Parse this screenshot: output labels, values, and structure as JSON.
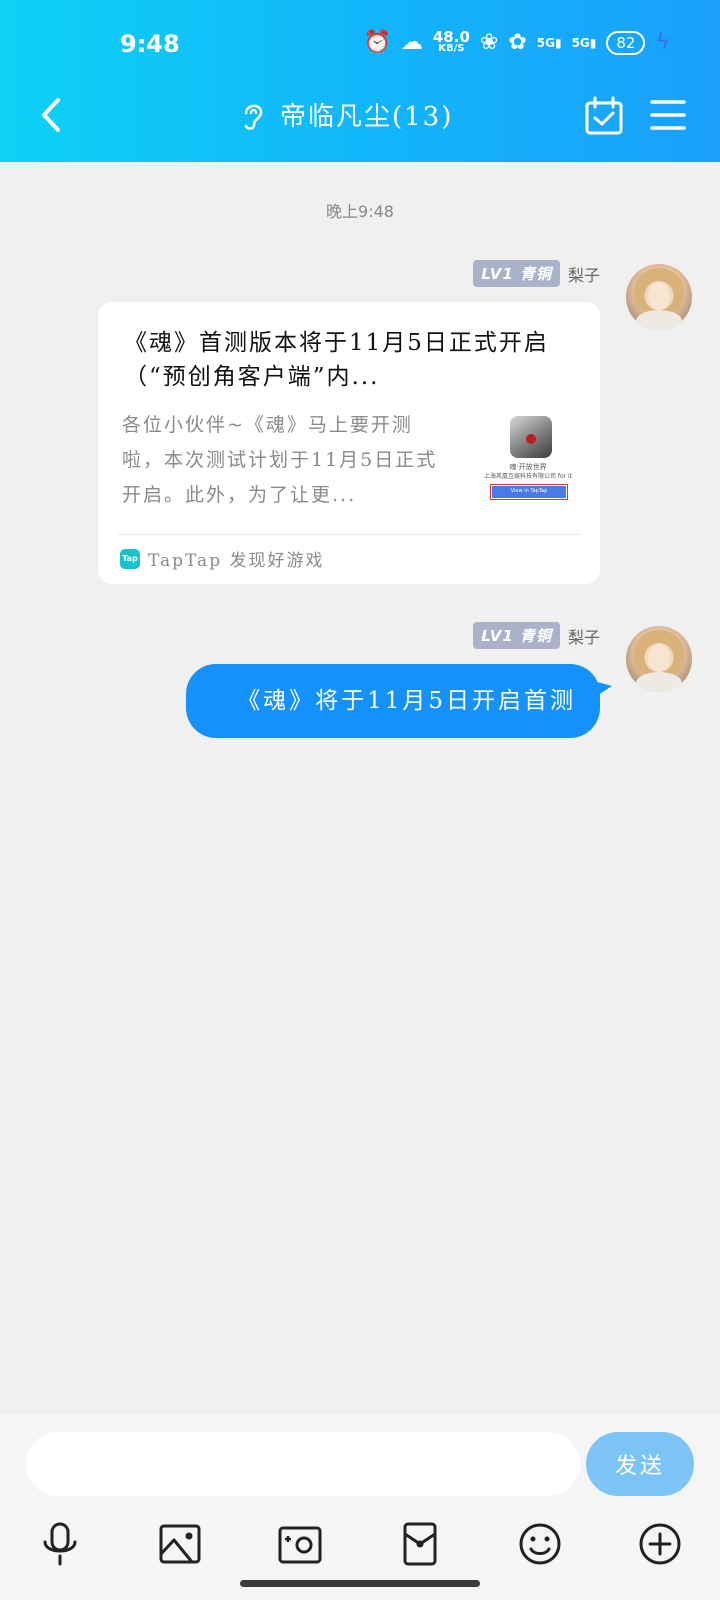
{
  "status_bar": {
    "time": "9:48",
    "net_speed_value": "48.0",
    "net_speed_unit": "KB/S",
    "signal1": "5G",
    "signal2": "5G",
    "battery": "82"
  },
  "header": {
    "title": "帝临凡尘(13)"
  },
  "chat": {
    "timestamp": "晚上9:48",
    "messages": [
      {
        "badge": "LV1 青铜",
        "sender": "梨子",
        "type": "link_card",
        "title": "《魂》首测版本将于11月5日正式开启（“预创角客户端”内...",
        "description": "各位小伙伴~《魂》马上要开测啦，本次测试计划于11月5日正式开启。此外，为了让更...",
        "thumb_title": "魂·开放世界",
        "thumb_sub": "上海风凰互娱科技有限公司 for it",
        "thumb_button": "View in TapTap",
        "source_logo": "Tap",
        "source": "TapTap 发现好游戏"
      },
      {
        "badge": "LV1 青铜",
        "sender": "梨子",
        "type": "text",
        "text": "《魂》将于11月5日开启首测"
      }
    ]
  },
  "input": {
    "value": "",
    "send_label": "发送"
  },
  "toolbar": {
    "items": [
      "mic-icon",
      "image-icon",
      "camera-icon",
      "red-packet-icon",
      "emoji-icon",
      "plus-icon"
    ]
  },
  "colors": {
    "header_start": "#0dd2f5",
    "header_end": "#1aa0fb",
    "bubble": "#1592fa",
    "send_button": "#7cc4f6",
    "badge": "#a9b2c8"
  }
}
